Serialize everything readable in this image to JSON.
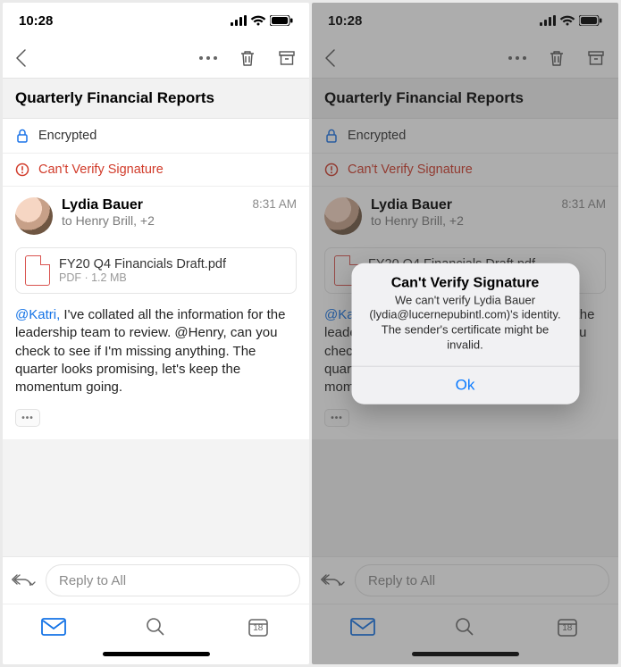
{
  "status": {
    "time": "10:28"
  },
  "subject": "Quarterly Financial Reports",
  "encrypted_label": "Encrypted",
  "signature_warning": "Can't Verify Signature",
  "sender": {
    "name": "Lydia Bauer",
    "recipients": "to Henry Brill, +2",
    "time": "8:31 AM"
  },
  "attachment": {
    "name": "FY20 Q4 Financials Draft.pdf",
    "meta": "PDF · 1.2 MB"
  },
  "body": {
    "mention": "@Katri,",
    "text": " I've collated all the information for the leadership team to review. @Henry, can you check to see if I'm missing anything. The quarter looks promising, let's keep the momentum going."
  },
  "reply_placeholder": "Reply to All",
  "calendar_day": "18",
  "dialog": {
    "title": "Can't Verify Signature",
    "body": "We can't verify Lydia Bauer (lydia@lucernepubintl.com)'s identity. The sender's certificate might be invalid.",
    "ok": "Ok"
  }
}
